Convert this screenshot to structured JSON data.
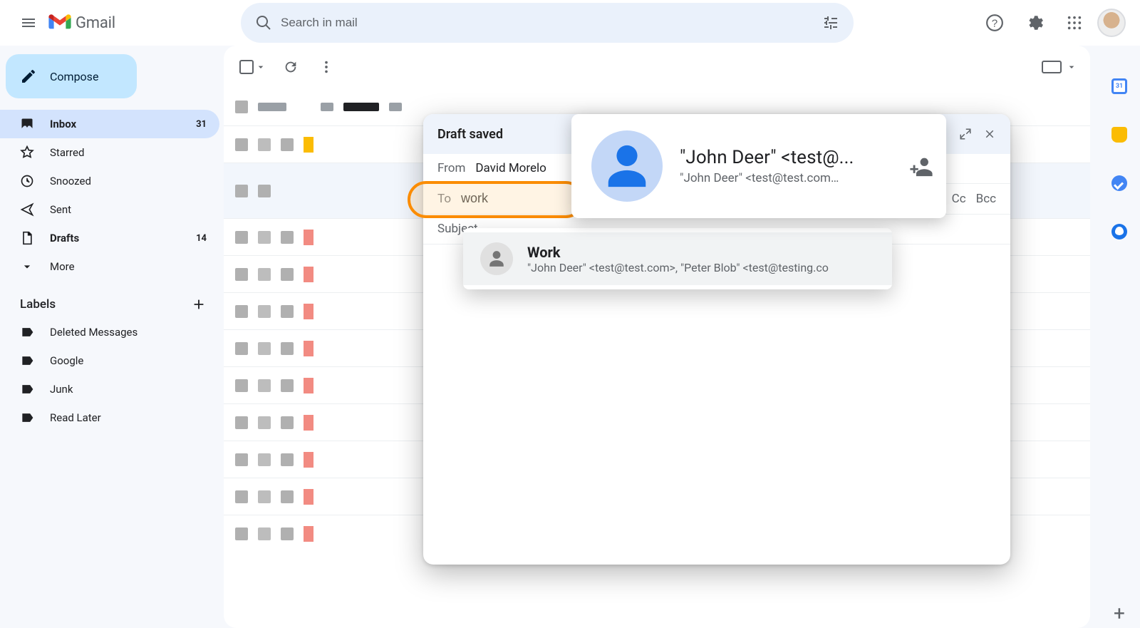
{
  "header": {
    "product": "Gmail",
    "search_placeholder": "Search in mail"
  },
  "sidebar": {
    "compose": "Compose",
    "nav": [
      {
        "icon": "inbox",
        "label": "Inbox",
        "count": "31",
        "active": true,
        "bold": true
      },
      {
        "icon": "star",
        "label": "Starred",
        "count": "",
        "active": false,
        "bold": false
      },
      {
        "icon": "snooze",
        "label": "Snoozed",
        "count": "",
        "active": false,
        "bold": false
      },
      {
        "icon": "sent",
        "label": "Sent",
        "count": "",
        "active": false,
        "bold": false
      },
      {
        "icon": "drafts",
        "label": "Drafts",
        "count": "14",
        "active": false,
        "bold": true
      },
      {
        "icon": "more",
        "label": "More",
        "count": "",
        "active": false,
        "bold": false
      }
    ],
    "labels_header": "Labels",
    "labels": [
      {
        "label": "Deleted Messages"
      },
      {
        "label": "Google"
      },
      {
        "label": "Junk"
      },
      {
        "label": "Read Later"
      }
    ]
  },
  "compose_dialog": {
    "title": "Draft saved",
    "from_label": "From",
    "from_value": "David Morelo",
    "to_label": "To",
    "to_value": "work",
    "subject_label": "Subject",
    "cc": "Cc",
    "bcc": "Bcc"
  },
  "contact_card": {
    "name": "\"John Deer\" <test@...",
    "email": "\"John Deer\" <test@test.com…"
  },
  "suggestion": {
    "title": "Work",
    "subtitle": "\"John Deer\" <test@test.com>, \"Peter Blob\" <test@testing.co"
  }
}
